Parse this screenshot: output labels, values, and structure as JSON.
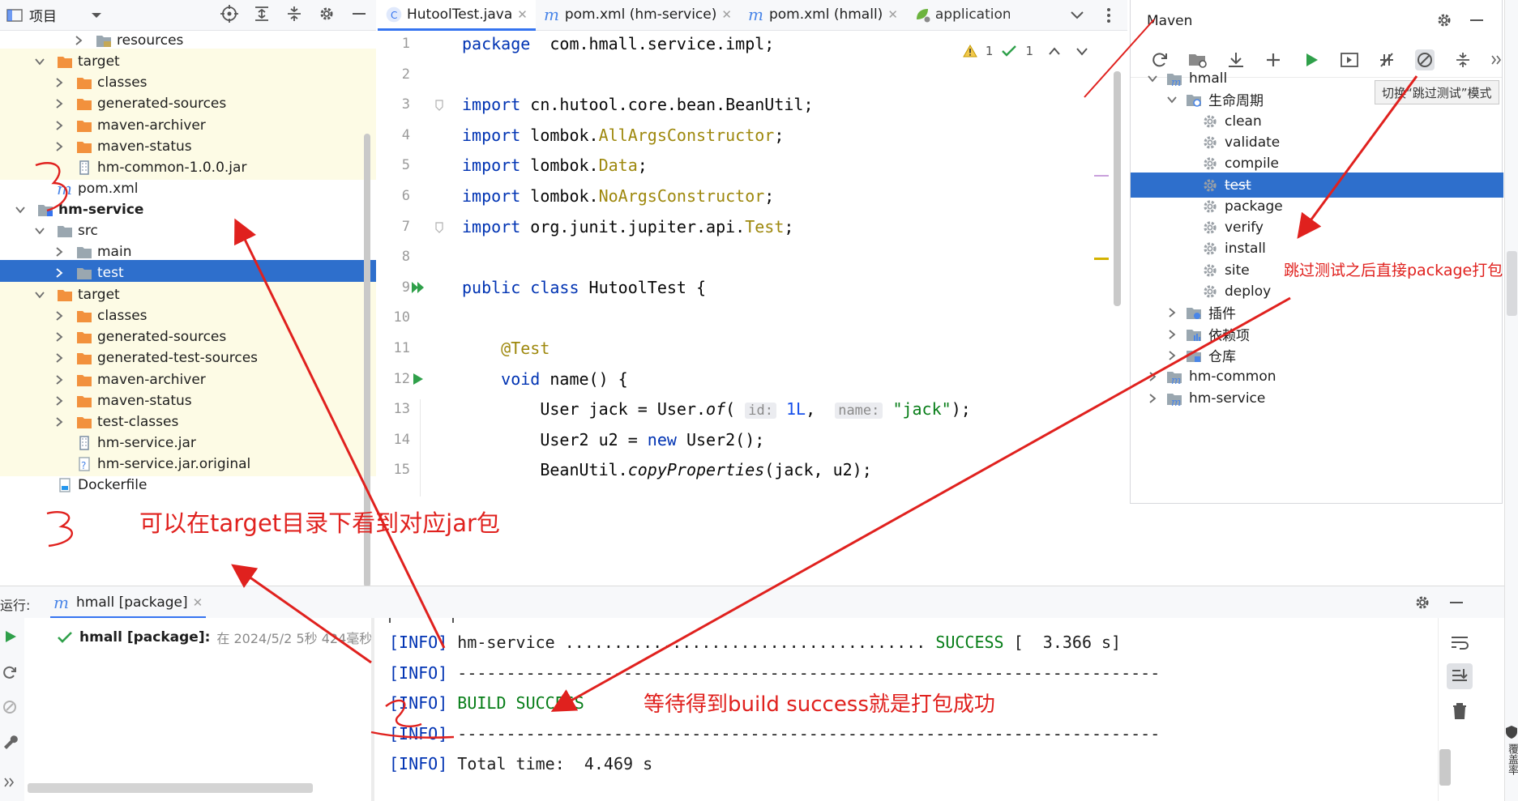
{
  "project": {
    "title": "项目",
    "tree": [
      {
        "label": "resources",
        "icon": "resources-folder-icon",
        "state": "collapsed"
      },
      {
        "label": "target",
        "icon": "excluded-folder-icon",
        "state": "expanded"
      },
      {
        "label": "classes",
        "icon": "excluded-folder-icon",
        "state": "collapsed"
      },
      {
        "label": "generated-sources",
        "icon": "excluded-folder-icon",
        "state": "collapsed"
      },
      {
        "label": "maven-archiver",
        "icon": "excluded-folder-icon",
        "state": "collapsed"
      },
      {
        "label": "maven-status",
        "icon": "excluded-folder-icon",
        "state": "collapsed"
      },
      {
        "label": "hm-common-1.0.0.jar",
        "icon": "jar-file-icon",
        "state": "leaf"
      },
      {
        "label": "pom.xml",
        "icon": "maven-file-icon",
        "state": "leaf"
      },
      {
        "label": "hm-service",
        "icon": "module-folder-icon",
        "state": "expanded"
      },
      {
        "label": "src",
        "icon": "folder-icon",
        "state": "expanded"
      },
      {
        "label": "main",
        "icon": "folder-icon",
        "state": "collapsed"
      },
      {
        "label": "test",
        "icon": "folder-icon",
        "state": "collapsed"
      },
      {
        "label": "target",
        "icon": "excluded-folder-icon",
        "state": "expanded"
      },
      {
        "label": "classes",
        "icon": "excluded-folder-icon",
        "state": "collapsed"
      },
      {
        "label": "generated-sources",
        "icon": "excluded-folder-icon",
        "state": "collapsed"
      },
      {
        "label": "generated-test-sources",
        "icon": "excluded-folder-icon",
        "state": "collapsed"
      },
      {
        "label": "maven-archiver",
        "icon": "excluded-folder-icon",
        "state": "collapsed"
      },
      {
        "label": "maven-status",
        "icon": "excluded-folder-icon",
        "state": "collapsed"
      },
      {
        "label": "test-classes",
        "icon": "excluded-folder-icon",
        "state": "collapsed"
      },
      {
        "label": "hm-service.jar",
        "icon": "jar-file-icon",
        "state": "leaf"
      },
      {
        "label": "hm-service.jar.original",
        "icon": "unknown-file-icon",
        "state": "leaf"
      },
      {
        "label": "Dockerfile",
        "icon": "docker-file-icon",
        "state": "leaf"
      }
    ]
  },
  "editor": {
    "tabs": [
      {
        "label": "HutoolTest.java"
      },
      {
        "label": "pom.xml (hm-service)"
      },
      {
        "label": "pom.xml (hmall)"
      },
      {
        "label": "application-d"
      }
    ],
    "inspections": {
      "warnings": "1",
      "checks": "1"
    },
    "code": [
      {
        "line": "1",
        "parts": [
          [
            "kw",
            "package"
          ],
          [
            "",
            "  com.hmall.service.impl;"
          ]
        ]
      },
      {
        "line": "2",
        "parts": []
      },
      {
        "line": "3",
        "parts": [
          [
            "kw",
            "import"
          ],
          [
            "",
            " cn.hutool.core.bean.BeanUtil;"
          ]
        ]
      },
      {
        "line": "4",
        "parts": [
          [
            "kw",
            "import"
          ],
          [
            "",
            " lombok."
          ],
          [
            "an",
            "AllArgsConstructor"
          ],
          [
            "",
            ";"
          ]
        ]
      },
      {
        "line": "5",
        "parts": [
          [
            "kw",
            "import"
          ],
          [
            "",
            " lombok."
          ],
          [
            "an",
            "Data"
          ],
          [
            "",
            ";"
          ]
        ]
      },
      {
        "line": "6",
        "parts": [
          [
            "kw",
            "import"
          ],
          [
            "",
            " lombok."
          ],
          [
            "an",
            "NoArgsConstructor"
          ],
          [
            "",
            ";"
          ]
        ]
      },
      {
        "line": "7",
        "parts": [
          [
            "kw",
            "import"
          ],
          [
            "",
            " org.junit.jupiter.api."
          ],
          [
            "an",
            "Test"
          ],
          [
            "",
            ";"
          ]
        ]
      },
      {
        "line": "8",
        "parts": []
      },
      {
        "line": "9",
        "parts": [
          [
            "kw",
            "public class"
          ],
          [
            "",
            " HutoolTest {"
          ]
        ]
      },
      {
        "line": "10",
        "parts": []
      },
      {
        "line": "11",
        "parts": [
          [
            "",
            "    "
          ],
          [
            "an",
            "@Test"
          ]
        ]
      },
      {
        "line": "12",
        "parts": [
          [
            "",
            "    "
          ],
          [
            "kw",
            "void"
          ],
          [
            "",
            " name() {"
          ]
        ]
      },
      {
        "line": "13",
        "parts": [
          [
            "",
            "        User jack = User."
          ],
          [
            "it",
            "of"
          ],
          [
            "",
            "( "
          ],
          [
            "hint",
            "id:"
          ],
          [
            "",
            " "
          ],
          [
            "nm",
            "1L"
          ],
          [
            "",
            ",  "
          ],
          [
            "hint",
            "name:"
          ],
          [
            "",
            " "
          ],
          [
            "st",
            "\"jack\""
          ],
          [
            "",
            ");"
          ]
        ]
      },
      {
        "line": "14",
        "parts": [
          [
            "",
            "        User2 u2 = "
          ],
          [
            "kw",
            "new"
          ],
          [
            "",
            " User2();"
          ]
        ]
      },
      {
        "line": "15",
        "parts": [
          [
            "",
            "        BeanUtil."
          ],
          [
            "it",
            "copyProperties"
          ],
          [
            "",
            "(jack, u2);"
          ]
        ]
      }
    ]
  },
  "maven": {
    "title": "Maven",
    "tooltip": "切换“跳过测试”模式",
    "tree": [
      {
        "label": "hmall",
        "icon": "maven-project-icon",
        "state": "expanded"
      },
      {
        "label": "生命周期",
        "icon": "lifecycle-folder-icon",
        "state": "expanded"
      },
      {
        "label": "clean",
        "icon": "gear-icon",
        "state": "leaf"
      },
      {
        "label": "validate",
        "icon": "gear-icon",
        "state": "leaf"
      },
      {
        "label": "compile",
        "icon": "gear-icon",
        "state": "leaf"
      },
      {
        "label": "test",
        "icon": "gear-icon",
        "state": "leaf",
        "struck": true
      },
      {
        "label": "package",
        "icon": "gear-icon",
        "state": "leaf"
      },
      {
        "label": "verify",
        "icon": "gear-icon",
        "state": "leaf"
      },
      {
        "label": "install",
        "icon": "gear-icon",
        "state": "leaf"
      },
      {
        "label": "site",
        "icon": "gear-icon",
        "state": "leaf"
      },
      {
        "label": "deploy",
        "icon": "gear-icon",
        "state": "leaf"
      },
      {
        "label": "插件",
        "icon": "plugins-folder-icon",
        "state": "collapsed"
      },
      {
        "label": "依赖项",
        "icon": "dependencies-folder-icon",
        "state": "collapsed"
      },
      {
        "label": "仓库",
        "icon": "repository-folder-icon",
        "state": "collapsed"
      },
      {
        "label": "hm-common",
        "icon": "maven-project-icon",
        "state": "collapsed"
      },
      {
        "label": "hm-service",
        "icon": "maven-project-icon",
        "state": "collapsed"
      }
    ]
  },
  "run": {
    "label": "运行:",
    "tab": "hmall [package]",
    "tree_item": {
      "name": "hmall [package]:",
      "detail": "在 2024/5/2 5秒 424毫秒"
    },
    "console": [
      {
        "parts": [
          [
            "info",
            "[INFO]"
          ],
          [
            "",
            " hm-service ..................................... "
          ],
          [
            "ok",
            "SUCCESS"
          ],
          [
            "",
            " [  3.366 s]"
          ]
        ]
      },
      {
        "parts": [
          [
            "info",
            "[INFO]"
          ],
          [
            "",
            " ------------------------------------------------------------------------"
          ]
        ]
      },
      {
        "parts": [
          [
            "info",
            "[INFO]"
          ],
          [
            "",
            " "
          ],
          [
            "ok",
            "BUILD SUCCESS"
          ]
        ]
      },
      {
        "parts": [
          [
            "info",
            "[INFO]"
          ],
          [
            "",
            " ------------------------------------------------------------------------"
          ]
        ]
      },
      {
        "parts": [
          [
            "info",
            "[INFO]"
          ],
          [
            "",
            " Total time:  4.469 s"
          ]
        ]
      }
    ]
  },
  "annotations": {
    "target_note": "可以在target目录下看到对应jar包",
    "skip_note": "跳过测试之后直接package打包",
    "success_note": "等待得到build success就是打包成功",
    "mark_3a": "3",
    "mark_3b": "3",
    "mark_2": "2"
  },
  "right_strip": {
    "bottom_label": "覆盖率"
  },
  "colors": {
    "accent": "#3574f0",
    "selection": "#2e6fcc",
    "annotation_red": "#e0211e",
    "success_green": "#067d17",
    "keyword_blue": "#0033b3"
  }
}
